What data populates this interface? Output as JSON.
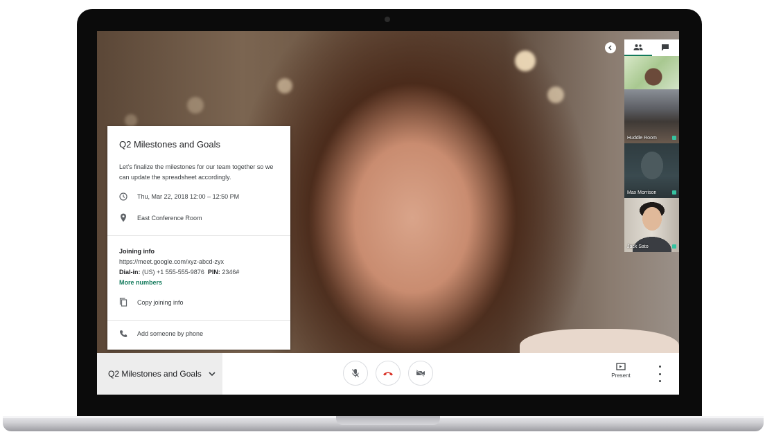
{
  "meeting": {
    "title": "Q2 Milestones and Goals",
    "description": "Let's finalize the milestones for our team together so we can update the spreadsheet accordingly.",
    "datetime": "Thu, Mar 22, 2018 12:00 – 12:50 PM",
    "location": "East Conference Room",
    "joining_heading": "Joining info",
    "url": "https://meet.google.com/xyz-abcd-zyx",
    "dial_label": "Dial-in:",
    "dial_in": "(US) +1 555-555-9876",
    "pin_label": "PIN:",
    "pin": "2346#",
    "more_numbers": "More numbers",
    "copy_label": "Copy joining info",
    "phone_label": "Add someone by phone"
  },
  "participants": [
    {
      "label": ""
    },
    {
      "label": "Huddle Room"
    },
    {
      "label": "Max Morrison"
    },
    {
      "label": "Jack Sato"
    }
  ],
  "bottom_bar": {
    "meeting_tab": "Q2 Milestones and Goals",
    "present_label": "Present"
  },
  "colors": {
    "accent": "#137a5c",
    "hangup": "#d93025",
    "mic_active": "#35c3a0"
  },
  "icons": [
    "clock-icon",
    "location-pin-icon",
    "copy-icon",
    "phone-icon",
    "people-icon",
    "chat-icon",
    "chevron-left-icon",
    "chevron-down-icon",
    "mic-off-icon",
    "hangup-icon",
    "camera-off-icon",
    "present-icon",
    "more-vert-icon"
  ]
}
